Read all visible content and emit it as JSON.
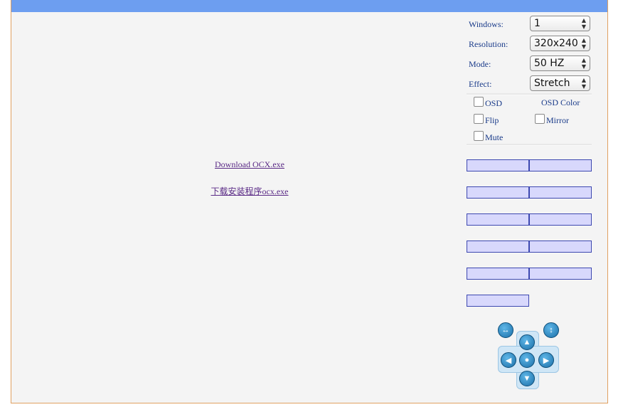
{
  "links": {
    "download_en": "Download OCX.exe",
    "download_cn": "下载安装程序ocx.exe"
  },
  "settings": {
    "windows": {
      "label": "Windows:",
      "value": "1"
    },
    "resolution": {
      "label": "Resolution:",
      "value": "320x240"
    },
    "mode": {
      "label": "Mode:",
      "value": "50 HZ"
    },
    "effect": {
      "label": "Effect:",
      "value": "Stretch"
    }
  },
  "options": {
    "osd": "OSD",
    "osd_color": "OSD Color",
    "flip": "Flip",
    "mirror": "Mirror",
    "mute": "Mute"
  },
  "colors": {
    "topbar": "#6d9ef0",
    "link": "#5a2a86",
    "label": "#1a3b8a",
    "bar_fill": "#d8d8fc",
    "bar_border": "#3d48b0"
  },
  "ptz_icons": [
    "horizontal-scan-icon",
    "vertical-scan-icon",
    "arrow-up-icon",
    "arrow-left-icon",
    "center-icon",
    "arrow-right-icon",
    "arrow-down-icon"
  ]
}
